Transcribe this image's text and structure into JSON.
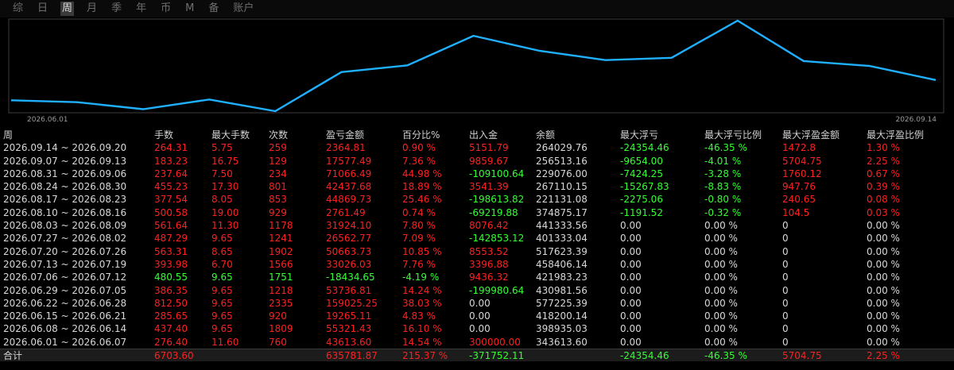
{
  "tabs": [
    "综",
    "日",
    "周",
    "月",
    "季",
    "年",
    "币",
    "M",
    "备",
    "账户"
  ],
  "active_tab": "周",
  "colors": {
    "line": "#1fb0ff",
    "up": "#ff2020",
    "down": "#33ff33",
    "neutral": "#d8d8d8"
  },
  "chart_data": {
    "type": "line",
    "x_labels": [
      "2026.06.01",
      "2026.09.14"
    ],
    "series": [
      {
        "values": [
          343613.6,
          398935.03,
          418200.14,
          577225.39,
          430981.56,
          421983.23,
          458406.14,
          517623.39,
          401333.04,
          374875.17,
          221131.08,
          267110.15,
          229076.0,
          256513.16,
          264029.76
        ]
      }
    ]
  },
  "table": {
    "headers": [
      "周",
      "手数",
      "最大手数",
      "次数",
      "盈亏金额",
      "百分比%",
      "出入金",
      "余额",
      "最大浮亏",
      "最大浮亏比例",
      "最大浮盈金额",
      "最大浮盈比例"
    ],
    "rows": [
      [
        "2026.09.14 ~ 2026.09.20",
        "264.31",
        "5.75",
        "259",
        "2364.81",
        "0.90 %",
        "5151.79",
        "264029.76",
        "-24354.46",
        "-46.35 %",
        "1472.8",
        "1.30 %"
      ],
      [
        "2026.09.07 ~ 2026.09.13",
        "183.23",
        "16.75",
        "129",
        "17577.49",
        "7.36 %",
        "9859.67",
        "256513.16",
        "-9654.00",
        "-4.01 %",
        "5704.75",
        "2.25 %"
      ],
      [
        "2026.08.31 ~ 2026.09.06",
        "237.64",
        "7.50",
        "234",
        "71066.49",
        "44.98 %",
        "-109100.64",
        "229076.00",
        "-7424.25",
        "-3.28 %",
        "1760.12",
        "0.67 %"
      ],
      [
        "2026.08.24 ~ 2026.08.30",
        "455.23",
        "17.30",
        "801",
        "42437.68",
        "18.89 %",
        "3541.39",
        "267110.15",
        "-15267.83",
        "-8.83 %",
        "947.76",
        "0.39 %"
      ],
      [
        "2026.08.17 ~ 2026.08.23",
        "377.54",
        "8.05",
        "853",
        "44869.73",
        "25.46 %",
        "-198613.82",
        "221131.08",
        "-2275.06",
        "-0.80 %",
        "240.65",
        "0.08 %"
      ],
      [
        "2026.08.10 ~ 2026.08.16",
        "500.58",
        "19.00",
        "929",
        "2761.49",
        "0.74 %",
        "-69219.88",
        "374875.17",
        "-1191.52",
        "-0.32 %",
        "104.5",
        "0.03 %"
      ],
      [
        "2026.08.03 ~ 2026.08.09",
        "561.64",
        "11.30",
        "1178",
        "31924.10",
        "7.80 %",
        "8076.42",
        "441333.56",
        "0.00",
        "0.00 %",
        "0",
        "0.00 %"
      ],
      [
        "2026.07.27 ~ 2026.08.02",
        "487.29",
        "9.65",
        "1241",
        "26562.77",
        "7.09 %",
        "-142853.12",
        "401333.04",
        "0.00",
        "0.00 %",
        "0",
        "0.00 %"
      ],
      [
        "2026.07.20 ~ 2026.07.26",
        "563.31",
        "8.65",
        "1902",
        "50663.73",
        "10.85 %",
        "8553.52",
        "517623.39",
        "0.00",
        "0.00 %",
        "0",
        "0.00 %"
      ],
      [
        "2026.07.13 ~ 2026.07.19",
        "393.98",
        "6.70",
        "1566",
        "33026.03",
        "7.76 %",
        "3396.88",
        "458406.14",
        "0.00",
        "0.00 %",
        "0",
        "0.00 %"
      ],
      [
        "2026.07.06 ~ 2026.07.12",
        "480.55",
        "9.65",
        "1751",
        "-18434.65",
        "-4.19 %",
        "9436.32",
        "421983.23",
        "0.00",
        "0.00 %",
        "0",
        "0.00 %"
      ],
      [
        "2026.06.29 ~ 2026.07.05",
        "386.35",
        "9.65",
        "1218",
        "53736.81",
        "14.24 %",
        "-199980.64",
        "430981.56",
        "0.00",
        "0.00 %",
        "0",
        "0.00 %"
      ],
      [
        "2026.06.22 ~ 2026.06.28",
        "812.50",
        "9.65",
        "2335",
        "159025.25",
        "38.03 %",
        "0.00",
        "577225.39",
        "0.00",
        "0.00 %",
        "0",
        "0.00 %"
      ],
      [
        "2026.06.15 ~ 2026.06.21",
        "285.65",
        "9.65",
        "920",
        "19265.11",
        "4.83 %",
        "0.00",
        "418200.14",
        "0.00",
        "0.00 %",
        "0",
        "0.00 %"
      ],
      [
        "2026.06.08 ~ 2026.06.14",
        "437.40",
        "9.65",
        "1809",
        "55321.43",
        "16.10 %",
        "0.00",
        "398935.03",
        "0.00",
        "0.00 %",
        "0",
        "0.00 %"
      ],
      [
        "2026.06.01 ~ 2026.06.07",
        "276.40",
        "11.60",
        "760",
        "43613.60",
        "14.54 %",
        "300000.00",
        "343613.60",
        "0.00",
        "0.00 %",
        "0",
        "0.00 %"
      ]
    ],
    "row_colors": [
      [
        "white",
        "red",
        "red",
        "red",
        "red",
        "red",
        "red",
        "white",
        "green",
        "green",
        "red",
        "red"
      ],
      [
        "white",
        "red",
        "red",
        "red",
        "red",
        "red",
        "red",
        "white",
        "green",
        "green",
        "red",
        "red"
      ],
      [
        "white",
        "red",
        "red",
        "red",
        "red",
        "red",
        "green",
        "white",
        "green",
        "green",
        "red",
        "red"
      ],
      [
        "white",
        "red",
        "red",
        "red",
        "red",
        "red",
        "red",
        "white",
        "green",
        "green",
        "red",
        "red"
      ],
      [
        "white",
        "red",
        "red",
        "red",
        "red",
        "red",
        "green",
        "white",
        "green",
        "green",
        "red",
        "red"
      ],
      [
        "white",
        "red",
        "red",
        "red",
        "red",
        "red",
        "green",
        "white",
        "green",
        "green",
        "red",
        "red"
      ],
      [
        "white",
        "red",
        "red",
        "red",
        "red",
        "red",
        "red",
        "white",
        "white",
        "white",
        "white",
        "white"
      ],
      [
        "white",
        "red",
        "red",
        "red",
        "red",
        "red",
        "green",
        "white",
        "white",
        "white",
        "white",
        "white"
      ],
      [
        "white",
        "red",
        "red",
        "red",
        "red",
        "red",
        "red",
        "white",
        "white",
        "white",
        "white",
        "white"
      ],
      [
        "white",
        "red",
        "red",
        "red",
        "red",
        "red",
        "red",
        "white",
        "white",
        "white",
        "white",
        "white"
      ],
      [
        "white",
        "green",
        "green",
        "green",
        "green",
        "green",
        "red",
        "white",
        "white",
        "white",
        "white",
        "white"
      ],
      [
        "white",
        "red",
        "red",
        "red",
        "red",
        "red",
        "green",
        "white",
        "white",
        "white",
        "white",
        "white"
      ],
      [
        "white",
        "red",
        "red",
        "red",
        "red",
        "red",
        "white",
        "white",
        "white",
        "white",
        "white",
        "white"
      ],
      [
        "white",
        "red",
        "red",
        "red",
        "red",
        "red",
        "white",
        "white",
        "white",
        "white",
        "white",
        "white"
      ],
      [
        "white",
        "red",
        "red",
        "red",
        "red",
        "red",
        "white",
        "white",
        "white",
        "white",
        "white",
        "white"
      ],
      [
        "white",
        "red",
        "red",
        "red",
        "red",
        "red",
        "red",
        "white",
        "white",
        "white",
        "white",
        "white"
      ]
    ],
    "total": [
      "合计",
      "6703.60",
      "",
      "",
      "635781.87",
      "215.37 %",
      "-371752.11",
      "",
      "-24354.46",
      "-46.35 %",
      "5704.75",
      "2.25 %"
    ],
    "total_colors": [
      "white",
      "red",
      "",
      "",
      "red",
      "red",
      "green",
      "",
      "green",
      "green",
      "red",
      "red"
    ]
  }
}
